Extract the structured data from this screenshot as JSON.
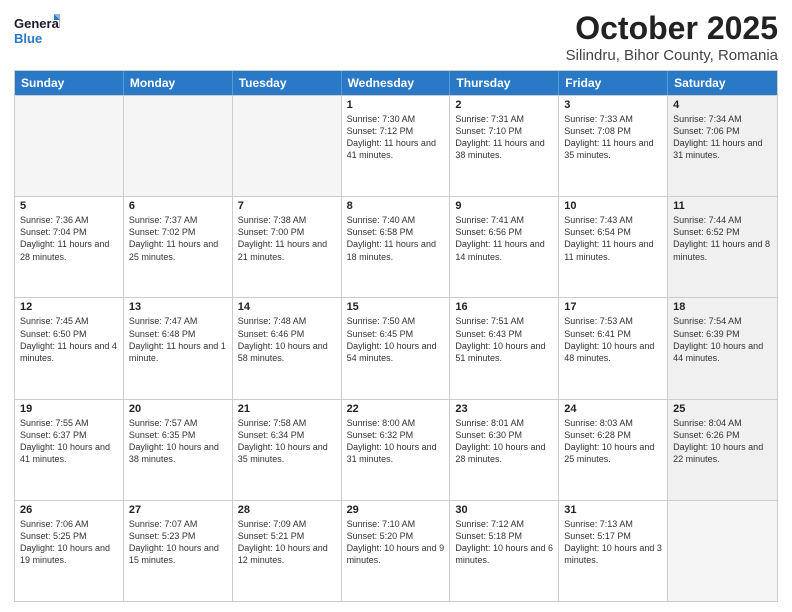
{
  "header": {
    "logo_general": "General",
    "logo_blue": "Blue",
    "title": "October 2025",
    "subtitle": "Silindru, Bihor County, Romania"
  },
  "days_of_week": [
    "Sunday",
    "Monday",
    "Tuesday",
    "Wednesday",
    "Thursday",
    "Friday",
    "Saturday"
  ],
  "weeks": [
    [
      {
        "day": "",
        "content": "",
        "empty": true
      },
      {
        "day": "",
        "content": "",
        "empty": true
      },
      {
        "day": "",
        "content": "",
        "empty": true
      },
      {
        "day": "1",
        "content": "Sunrise: 7:30 AM\nSunset: 7:12 PM\nDaylight: 11 hours and 41 minutes.",
        "empty": false,
        "shaded": false
      },
      {
        "day": "2",
        "content": "Sunrise: 7:31 AM\nSunset: 7:10 PM\nDaylight: 11 hours and 38 minutes.",
        "empty": false,
        "shaded": false
      },
      {
        "day": "3",
        "content": "Sunrise: 7:33 AM\nSunset: 7:08 PM\nDaylight: 11 hours and 35 minutes.",
        "empty": false,
        "shaded": false
      },
      {
        "day": "4",
        "content": "Sunrise: 7:34 AM\nSunset: 7:06 PM\nDaylight: 11 hours and 31 minutes.",
        "empty": false,
        "shaded": true
      }
    ],
    [
      {
        "day": "5",
        "content": "Sunrise: 7:36 AM\nSunset: 7:04 PM\nDaylight: 11 hours and 28 minutes.",
        "empty": false,
        "shaded": false
      },
      {
        "day": "6",
        "content": "Sunrise: 7:37 AM\nSunset: 7:02 PM\nDaylight: 11 hours and 25 minutes.",
        "empty": false,
        "shaded": false
      },
      {
        "day": "7",
        "content": "Sunrise: 7:38 AM\nSunset: 7:00 PM\nDaylight: 11 hours and 21 minutes.",
        "empty": false,
        "shaded": false
      },
      {
        "day": "8",
        "content": "Sunrise: 7:40 AM\nSunset: 6:58 PM\nDaylight: 11 hours and 18 minutes.",
        "empty": false,
        "shaded": false
      },
      {
        "day": "9",
        "content": "Sunrise: 7:41 AM\nSunset: 6:56 PM\nDaylight: 11 hours and 14 minutes.",
        "empty": false,
        "shaded": false
      },
      {
        "day": "10",
        "content": "Sunrise: 7:43 AM\nSunset: 6:54 PM\nDaylight: 11 hours and 11 minutes.",
        "empty": false,
        "shaded": false
      },
      {
        "day": "11",
        "content": "Sunrise: 7:44 AM\nSunset: 6:52 PM\nDaylight: 11 hours and 8 minutes.",
        "empty": false,
        "shaded": true
      }
    ],
    [
      {
        "day": "12",
        "content": "Sunrise: 7:45 AM\nSunset: 6:50 PM\nDaylight: 11 hours and 4 minutes.",
        "empty": false,
        "shaded": false
      },
      {
        "day": "13",
        "content": "Sunrise: 7:47 AM\nSunset: 6:48 PM\nDaylight: 11 hours and 1 minute.",
        "empty": false,
        "shaded": false
      },
      {
        "day": "14",
        "content": "Sunrise: 7:48 AM\nSunset: 6:46 PM\nDaylight: 10 hours and 58 minutes.",
        "empty": false,
        "shaded": false
      },
      {
        "day": "15",
        "content": "Sunrise: 7:50 AM\nSunset: 6:45 PM\nDaylight: 10 hours and 54 minutes.",
        "empty": false,
        "shaded": false
      },
      {
        "day": "16",
        "content": "Sunrise: 7:51 AM\nSunset: 6:43 PM\nDaylight: 10 hours and 51 minutes.",
        "empty": false,
        "shaded": false
      },
      {
        "day": "17",
        "content": "Sunrise: 7:53 AM\nSunset: 6:41 PM\nDaylight: 10 hours and 48 minutes.",
        "empty": false,
        "shaded": false
      },
      {
        "day": "18",
        "content": "Sunrise: 7:54 AM\nSunset: 6:39 PM\nDaylight: 10 hours and 44 minutes.",
        "empty": false,
        "shaded": true
      }
    ],
    [
      {
        "day": "19",
        "content": "Sunrise: 7:55 AM\nSunset: 6:37 PM\nDaylight: 10 hours and 41 minutes.",
        "empty": false,
        "shaded": false
      },
      {
        "day": "20",
        "content": "Sunrise: 7:57 AM\nSunset: 6:35 PM\nDaylight: 10 hours and 38 minutes.",
        "empty": false,
        "shaded": false
      },
      {
        "day": "21",
        "content": "Sunrise: 7:58 AM\nSunset: 6:34 PM\nDaylight: 10 hours and 35 minutes.",
        "empty": false,
        "shaded": false
      },
      {
        "day": "22",
        "content": "Sunrise: 8:00 AM\nSunset: 6:32 PM\nDaylight: 10 hours and 31 minutes.",
        "empty": false,
        "shaded": false
      },
      {
        "day": "23",
        "content": "Sunrise: 8:01 AM\nSunset: 6:30 PM\nDaylight: 10 hours and 28 minutes.",
        "empty": false,
        "shaded": false
      },
      {
        "day": "24",
        "content": "Sunrise: 8:03 AM\nSunset: 6:28 PM\nDaylight: 10 hours and 25 minutes.",
        "empty": false,
        "shaded": false
      },
      {
        "day": "25",
        "content": "Sunrise: 8:04 AM\nSunset: 6:26 PM\nDaylight: 10 hours and 22 minutes.",
        "empty": false,
        "shaded": true
      }
    ],
    [
      {
        "day": "26",
        "content": "Sunrise: 7:06 AM\nSunset: 5:25 PM\nDaylight: 10 hours and 19 minutes.",
        "empty": false,
        "shaded": false
      },
      {
        "day": "27",
        "content": "Sunrise: 7:07 AM\nSunset: 5:23 PM\nDaylight: 10 hours and 15 minutes.",
        "empty": false,
        "shaded": false
      },
      {
        "day": "28",
        "content": "Sunrise: 7:09 AM\nSunset: 5:21 PM\nDaylight: 10 hours and 12 minutes.",
        "empty": false,
        "shaded": false
      },
      {
        "day": "29",
        "content": "Sunrise: 7:10 AM\nSunset: 5:20 PM\nDaylight: 10 hours and 9 minutes.",
        "empty": false,
        "shaded": false
      },
      {
        "day": "30",
        "content": "Sunrise: 7:12 AM\nSunset: 5:18 PM\nDaylight: 10 hours and 6 minutes.",
        "empty": false,
        "shaded": false
      },
      {
        "day": "31",
        "content": "Sunrise: 7:13 AM\nSunset: 5:17 PM\nDaylight: 10 hours and 3 minutes.",
        "empty": false,
        "shaded": false
      },
      {
        "day": "",
        "content": "",
        "empty": true,
        "shaded": true
      }
    ]
  ]
}
